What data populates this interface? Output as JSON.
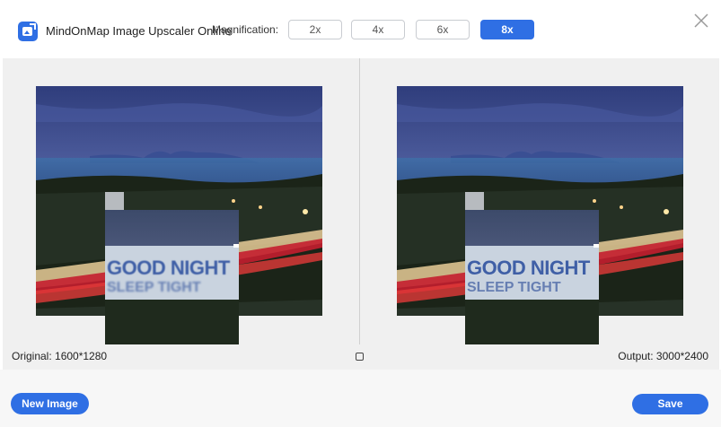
{
  "header": {
    "app_title": "MindOnMap Image Upscaler Online",
    "magnification_label": "Magnification:",
    "magnification_options": [
      {
        "label": "2x",
        "active": false
      },
      {
        "label": "4x",
        "active": false
      },
      {
        "label": "6x",
        "active": false
      },
      {
        "label": "8x",
        "active": true
      }
    ]
  },
  "preview": {
    "sign_text_line1": "GOOD NIGHT",
    "sign_text_line2": "SLEEP TIGHT"
  },
  "info_bar": {
    "original": "Original: 1600*1280",
    "output": "Output: 3000*2400"
  },
  "footer": {
    "new_image_label": "New Image",
    "save_label": "Save"
  },
  "colors": {
    "accent": "#2f6fe4",
    "preview_bg": "#f0f0f0"
  },
  "icons": {
    "logo": "image-upscale-logo-icon",
    "close": "close-icon",
    "compare": "compare-square-icon"
  }
}
